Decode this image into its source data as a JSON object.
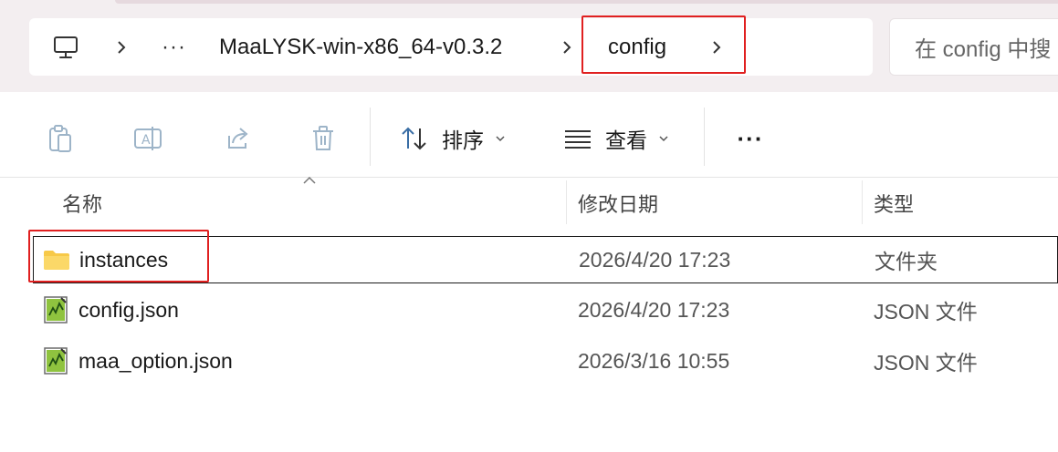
{
  "breadcrumb": {
    "overflow_label": "···",
    "items": [
      {
        "label": "MaaLYSK-win-x86_64-v0.3.2"
      },
      {
        "label": "config"
      }
    ]
  },
  "search": {
    "placeholder": "在 config 中搜"
  },
  "toolbar": {
    "sort_label": "排序",
    "view_label": "查看",
    "more_label": "···"
  },
  "columns": {
    "name": "名称",
    "date": "修改日期",
    "type": "类型"
  },
  "files": [
    {
      "name": "instances",
      "date": "2026/4/20 17:23",
      "type": "文件夹",
      "icon": "folder-icon"
    },
    {
      "name": "config.json",
      "date": "2026/4/20 17:23",
      "type": "JSON 文件",
      "icon": "json-file-icon"
    },
    {
      "name": "maa_option.json",
      "date": "2026/3/16 10:55",
      "type": "JSON 文件",
      "icon": "json-file-icon"
    }
  ],
  "colors": {
    "highlight": "#e02020",
    "topbar_bg": "#f3eef0",
    "folder_yellow": "#f7c948"
  }
}
